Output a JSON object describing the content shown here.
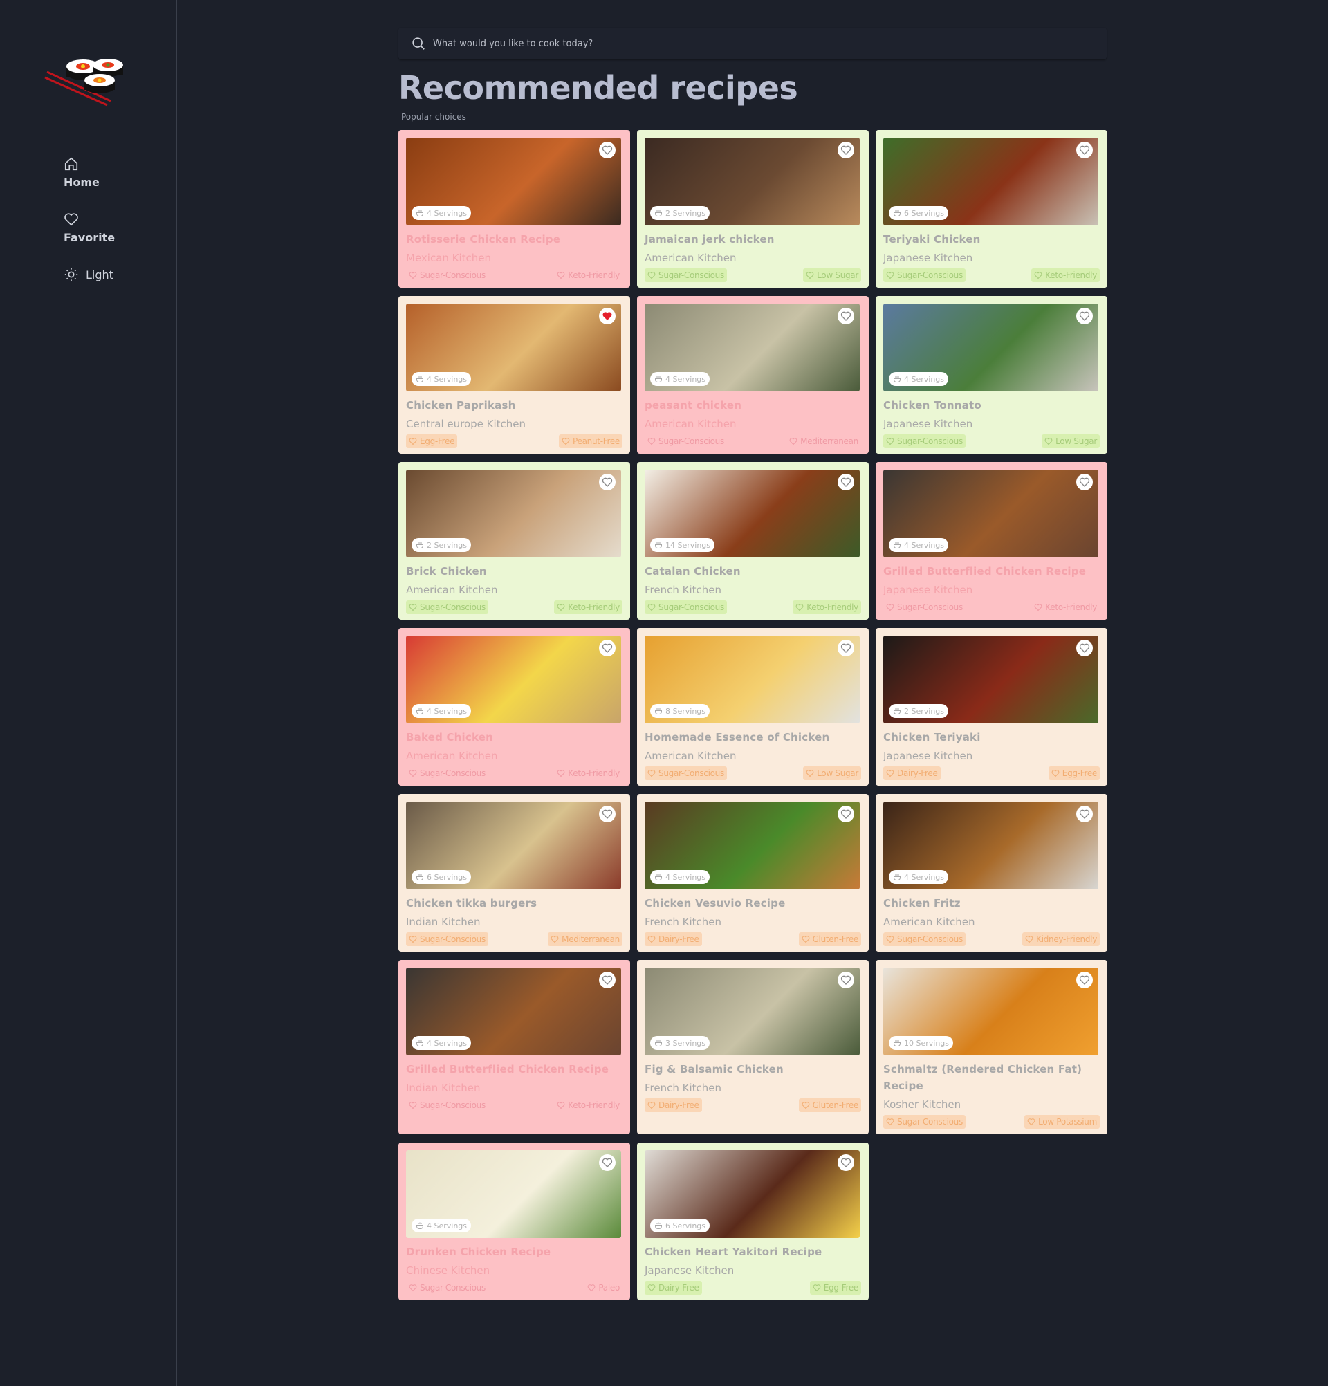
{
  "nav": {
    "home": "Home",
    "favorite": "Favorite",
    "light": "Light"
  },
  "search": {
    "placeholder": "What would you like to cook today?"
  },
  "header": {
    "title": "Recommended recipes",
    "subtitle": "Popular choices"
  },
  "recipes": [
    {
      "name": "Rotisserie Chicken Recipe",
      "kitchen": "Mexican Kitchen",
      "servings": "4 Servings",
      "tag1": "Sugar-Conscious",
      "tag2": "Keto-Friendly",
      "color": "pink",
      "favorite": false,
      "photo": [
        "#8a3d12",
        "#c8652a",
        "#3a2a20"
      ]
    },
    {
      "name": "Jamaican jerk chicken",
      "kitchen": "American Kitchen",
      "servings": "2 Servings",
      "tag1": "Sugar-Conscious",
      "tag2": "Low Sugar",
      "color": "green",
      "favorite": false,
      "photo": [
        "#3b2a22",
        "#6b4a32",
        "#b98b5d"
      ]
    },
    {
      "name": "Teriyaki Chicken",
      "kitchen": "Japanese Kitchen",
      "servings": "6 Servings",
      "tag1": "Sugar-Conscious",
      "tag2": "Keto-Friendly",
      "color": "green",
      "favorite": false,
      "photo": [
        "#3e6e2a",
        "#8a3318",
        "#c9c2b6"
      ]
    },
    {
      "name": "Chicken Paprikash",
      "kitchen": "Central europe Kitchen",
      "servings": "4 Servings",
      "tag1": "Egg-Free",
      "tag2": "Peanut-Free",
      "color": "cream",
      "favorite": true,
      "photo": [
        "#b5602a",
        "#e3b872",
        "#8a4a20"
      ]
    },
    {
      "name": "peasant chicken",
      "kitchen": "American Kitchen",
      "servings": "4 Servings",
      "tag1": "Sugar-Conscious",
      "tag2": "Mediterranean",
      "color": "pink",
      "favorite": false,
      "photo": [
        "#8c8a74",
        "#c8c2a6",
        "#4a5b3a"
      ]
    },
    {
      "name": "Chicken Tonnato",
      "kitchen": "Japanese Kitchen",
      "servings": "4 Servings",
      "tag1": "Sugar-Conscious",
      "tag2": "Low Sugar",
      "color": "green",
      "favorite": false,
      "photo": [
        "#5b7aa0",
        "#4b7e3a",
        "#c8c4bc"
      ]
    },
    {
      "name": "Brick Chicken",
      "kitchen": "American Kitchen",
      "servings": "2 Servings",
      "tag1": "Sugar-Conscious",
      "tag2": "Keto-Friendly",
      "color": "green",
      "favorite": false,
      "photo": [
        "#6a4a30",
        "#c9a27a",
        "#e5dccd"
      ]
    },
    {
      "name": "Catalan Chicken",
      "kitchen": "French Kitchen",
      "servings": "14 Servings",
      "tag1": "Sugar-Conscious",
      "tag2": "Keto-Friendly",
      "color": "green",
      "favorite": false,
      "photo": [
        "#f3efe6",
        "#8a3e1a",
        "#3c5b28"
      ]
    },
    {
      "name": "Grilled Butterflied Chicken Recipe",
      "kitchen": "Japanese Kitchen",
      "servings": "4 Servings",
      "tag1": "Sugar-Conscious",
      "tag2": "Keto-Friendly",
      "color": "pink",
      "favorite": false,
      "photo": [
        "#3a3633",
        "#9a5a2a",
        "#6a4430"
      ]
    },
    {
      "name": "Baked Chicken",
      "kitchen": "American Kitchen",
      "servings": "4 Servings",
      "tag1": "Sugar-Conscious",
      "tag2": "Keto-Friendly",
      "color": "pink",
      "favorite": false,
      "photo": [
        "#d73a34",
        "#f3d64a",
        "#c8a46a"
      ]
    },
    {
      "name": "Homemade Essence of Chicken",
      "kitchen": "American Kitchen",
      "servings": "8 Servings",
      "tag1": "Sugar-Conscious",
      "tag2": "Low Sugar",
      "color": "cream",
      "favorite": false,
      "photo": [
        "#e6a030",
        "#f4d070",
        "#e2e2e0"
      ]
    },
    {
      "name": "Chicken Teriyaki",
      "kitchen": "Japanese Kitchen",
      "servings": "2 Servings",
      "tag1": "Dairy-Free",
      "tag2": "Egg-Free",
      "color": "cream",
      "favorite": false,
      "photo": [
        "#1c1a18",
        "#8a2a18",
        "#4a6a2a"
      ]
    },
    {
      "name": "Chicken tikka burgers",
      "kitchen": "Indian Kitchen",
      "servings": "6 Servings",
      "tag1": "Sugar-Conscious",
      "tag2": "Mediterranean",
      "color": "cream",
      "favorite": false,
      "photo": [
        "#6a5a48",
        "#d8c28e",
        "#8a3a2a"
      ]
    },
    {
      "name": "Chicken Vesuvio Recipe",
      "kitchen": "French Kitchen",
      "servings": "4 Servings",
      "tag1": "Dairy-Free",
      "tag2": "Gluten-Free",
      "color": "cream",
      "favorite": false,
      "photo": [
        "#5a3a22",
        "#4a8a2a",
        "#c87a38"
      ]
    },
    {
      "name": "Chicken Fritz",
      "kitchen": "American Kitchen",
      "servings": "4 Servings",
      "tag1": "Sugar-Conscious",
      "tag2": "Kidney-Friendly",
      "color": "cream",
      "favorite": false,
      "photo": [
        "#3a2418",
        "#a86a2a",
        "#d8d6d2"
      ]
    },
    {
      "name": "Grilled Butterflied Chicken Recipe",
      "kitchen": "Indian Kitchen",
      "servings": "4 Servings",
      "tag1": "Sugar-Conscious",
      "tag2": "Keto-Friendly",
      "color": "pink",
      "favorite": false,
      "photo": [
        "#3a3633",
        "#9a5a2a",
        "#6a4430"
      ]
    },
    {
      "name": "Fig & Balsamic Chicken",
      "kitchen": "French Kitchen",
      "servings": "3 Servings",
      "tag1": "Dairy-Free",
      "tag2": "Gluten-Free",
      "color": "cream",
      "favorite": false,
      "photo": [
        "#8c8a74",
        "#c8c2a6",
        "#4a5b3a"
      ]
    },
    {
      "name": "Schmaltz (Rendered Chicken Fat) Recipe",
      "kitchen": "Kosher Kitchen",
      "servings": "10 Servings",
      "tag1": "Sugar-Conscious",
      "tag2": "Low Potassium",
      "color": "cream",
      "favorite": false,
      "photo": [
        "#e8e4dc",
        "#d8801a",
        "#f0a030"
      ]
    },
    {
      "name": "Drunken Chicken Recipe",
      "kitchen": "Chinese Kitchen",
      "servings": "4 Servings",
      "tag1": "Sugar-Conscious",
      "tag2": "Paleo",
      "color": "pink",
      "favorite": false,
      "photo": [
        "#e8e2c8",
        "#f4f0dc",
        "#5a8a3a"
      ]
    },
    {
      "name": "Chicken Heart Yakitori Recipe",
      "kitchen": "Japanese Kitchen",
      "servings": "6 Servings",
      "tag1": "Dairy-Free",
      "tag2": "Egg-Free",
      "color": "green",
      "favorite": false,
      "photo": [
        "#e0dcd6",
        "#5a2a1a",
        "#f4d04a"
      ]
    }
  ]
}
